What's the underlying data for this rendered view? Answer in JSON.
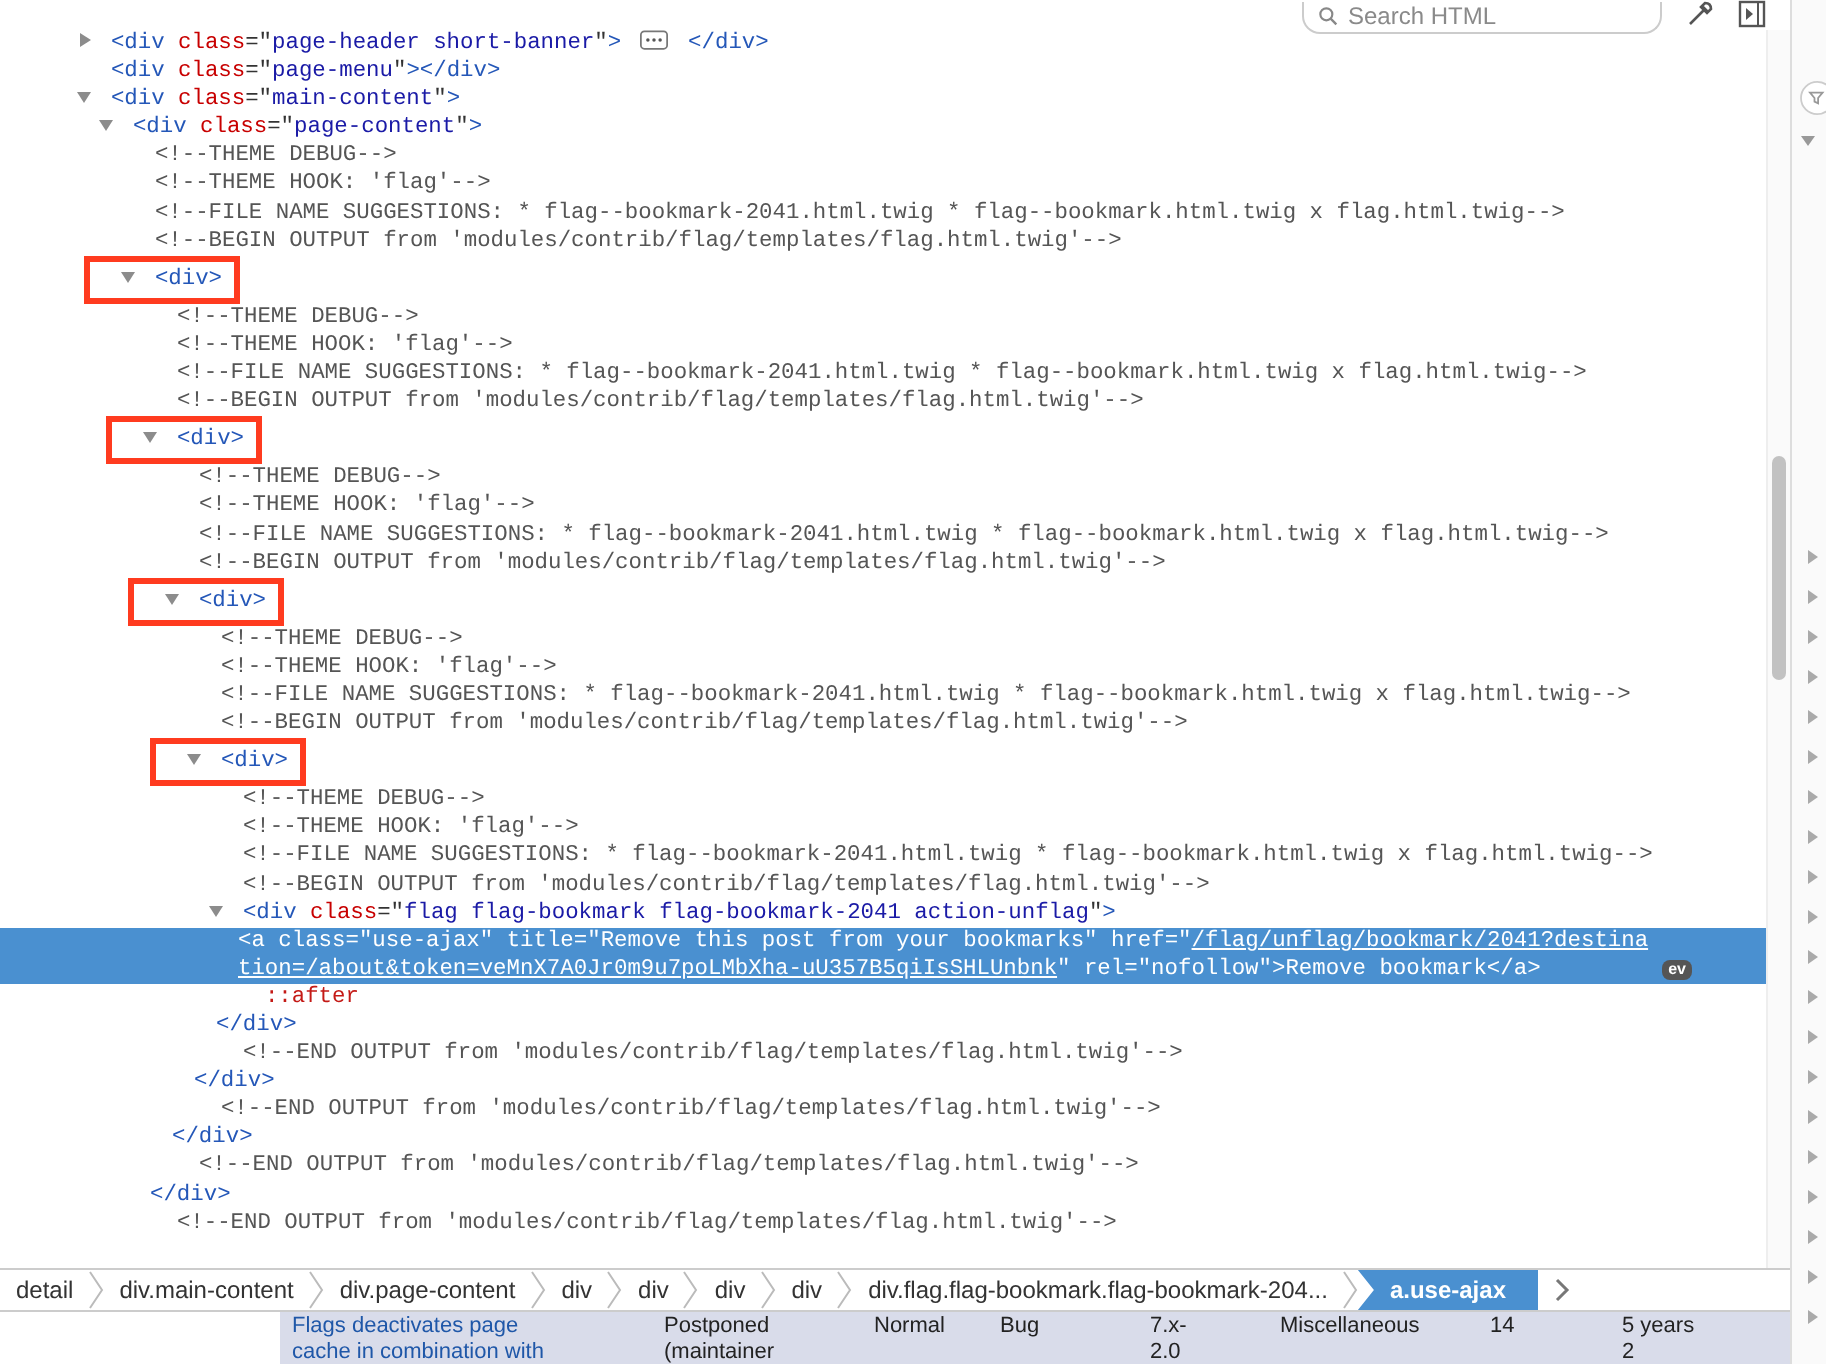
{
  "search": {
    "placeholder": "Search HTML"
  },
  "tree": [
    {
      "kind": "element",
      "selected": false,
      "boxed": false,
      "expanded": false,
      "code": [
        {
          "kind": "tag",
          "text": "<div"
        },
        {
          "kind": "attr",
          "text": " class"
        },
        {
          "kind": "punct",
          "text": "=\""
        },
        {
          "kind": "value",
          "text": "page-header short-banner"
        },
        {
          "kind": "punct",
          "text": "\""
        },
        {
          "kind": "tag",
          "text": ">"
        }
      ],
      "tail": [
        {
          "kind": "tag",
          "text": "</div>"
        }
      ]
    },
    {
      "kind": "element",
      "selected": false,
      "boxed": false,
      "code": [
        {
          "kind": "tag",
          "text": "<div"
        },
        {
          "kind": "attr",
          "text": " class"
        },
        {
          "kind": "punct",
          "text": "=\""
        },
        {
          "kind": "value",
          "text": "page-menu"
        },
        {
          "kind": "punct",
          "text": "\""
        },
        {
          "kind": "tag",
          "text": "></div>"
        }
      ]
    },
    {
      "kind": "element",
      "selected": false,
      "boxed": false,
      "expanded": true,
      "code": [
        {
          "kind": "tag",
          "text": "<div"
        },
        {
          "kind": "attr",
          "text": " class"
        },
        {
          "kind": "punct",
          "text": "=\""
        },
        {
          "kind": "value",
          "text": "main-content"
        },
        {
          "kind": "punct",
          "text": "\""
        },
        {
          "kind": "tag",
          "text": ">"
        }
      ],
      "children": [
        {
          "kind": "element",
          "selected": false,
          "boxed": false,
          "expanded": true,
          "code": [
            {
              "kind": "tag",
              "text": "<div"
            },
            {
              "kind": "attr",
              "text": " class"
            },
            {
              "kind": "punct",
              "text": "=\""
            },
            {
              "kind": "value",
              "text": "page-content"
            },
            {
              "kind": "punct",
              "text": "\""
            },
            {
              "kind": "tag",
              "text": ">"
            }
          ],
          "children": [
            {
              "kind": "comment",
              "selected": false,
              "boxed": false,
              "text": "<!--THEME DEBUG-->"
            },
            {
              "kind": "comment",
              "selected": false,
              "boxed": false,
              "text": "<!--THEME HOOK: 'flag'-->"
            },
            {
              "kind": "comment",
              "selected": false,
              "boxed": false,
              "text": "<!--FILE NAME SUGGESTIONS: * flag--bookmark-2041.html.twig * flag--bookmark.html.twig x flag.html.twig-->"
            },
            {
              "kind": "comment",
              "selected": false,
              "boxed": false,
              "text": "<!--BEGIN OUTPUT from 'modules/contrib/flag/templates/flag.html.twig'-->"
            },
            {
              "kind": "element",
              "selected": false,
              "boxed": true,
              "expanded": true,
              "code": [
                {
                  "kind": "tag",
                  "text": "<div>"
                }
              ],
              "children": [
                {
                  "kind": "comment",
                  "selected": false,
                  "boxed": false,
                  "text": "<!--THEME DEBUG-->"
                },
                {
                  "kind": "comment",
                  "selected": false,
                  "boxed": false,
                  "text": "<!--THEME HOOK: 'flag'-->"
                },
                {
                  "kind": "comment",
                  "selected": false,
                  "boxed": false,
                  "text": "<!--FILE NAME SUGGESTIONS: * flag--bookmark-2041.html.twig * flag--bookmark.html.twig x flag.html.twig-->"
                },
                {
                  "kind": "comment",
                  "selected": false,
                  "boxed": false,
                  "text": "<!--BEGIN OUTPUT from 'modules/contrib/flag/templates/flag.html.twig'-->"
                },
                {
                  "kind": "element",
                  "selected": false,
                  "boxed": true,
                  "expanded": true,
                  "code": [
                    {
                      "kind": "tag",
                      "text": "<div>"
                    }
                  ],
                  "closing": "</div>",
                  "children": [
                    {
                      "kind": "comment",
                      "selected": false,
                      "boxed": false,
                      "text": "<!--THEME DEBUG-->"
                    },
                    {
                      "kind": "comment",
                      "selected": false,
                      "boxed": false,
                      "text": "<!--THEME HOOK: 'flag'-->"
                    },
                    {
                      "kind": "comment",
                      "selected": false,
                      "boxed": false,
                      "text": "<!--FILE NAME SUGGESTIONS: * flag--bookmark-2041.html.twig * flag--bookmark.html.twig x flag.html.twig-->"
                    },
                    {
                      "kind": "comment",
                      "selected": false,
                      "boxed": false,
                      "text": "<!--BEGIN OUTPUT from 'modules/contrib/flag/templates/flag.html.twig'-->"
                    },
                    {
                      "kind": "element",
                      "selected": false,
                      "boxed": true,
                      "expanded": true,
                      "code": [
                        {
                          "kind": "tag",
                          "text": "<div>"
                        }
                      ],
                      "closing": "</div>",
                      "children": [
                        {
                          "kind": "comment",
                          "selected": false,
                          "boxed": false,
                          "text": "<!--THEME DEBUG-->"
                        },
                        {
                          "kind": "comment",
                          "selected": false,
                          "boxed": false,
                          "text": "<!--THEME HOOK: 'flag'-->"
                        },
                        {
                          "kind": "comment",
                          "selected": false,
                          "boxed": false,
                          "text": "<!--FILE NAME SUGGESTIONS: * flag--bookmark-2041.html.twig * flag--bookmark.html.twig x flag.html.twig-->"
                        },
                        {
                          "kind": "comment",
                          "selected": false,
                          "boxed": false,
                          "text": "<!--BEGIN OUTPUT from 'modules/contrib/flag/templates/flag.html.twig'-->"
                        },
                        {
                          "kind": "element",
                          "selected": false,
                          "boxed": true,
                          "expanded": true,
                          "code": [
                            {
                              "kind": "tag",
                              "text": "<div>"
                            }
                          ],
                          "closing": "</div>",
                          "children": [
                            {
                              "kind": "comment",
                              "selected": false,
                              "boxed": false,
                              "text": "<!--THEME DEBUG-->"
                            },
                            {
                              "kind": "comment",
                              "selected": false,
                              "boxed": false,
                              "text": "<!--THEME HOOK: 'flag'-->"
                            },
                            {
                              "kind": "comment",
                              "selected": false,
                              "boxed": false,
                              "text": "<!--FILE NAME SUGGESTIONS: * flag--bookmark-2041.html.twig * flag--bookmark.html.twig x flag.html.twig-->"
                            },
                            {
                              "kind": "comment",
                              "selected": false,
                              "boxed": false,
                              "text": "<!--BEGIN OUTPUT from 'modules/contrib/flag/templates/flag.html.twig'-->"
                            },
                            {
                              "kind": "element",
                              "selected": false,
                              "boxed": false,
                              "expanded": true,
                              "code": [
                                {
                                  "kind": "tag",
                                  "text": "<div"
                                },
                                {
                                  "kind": "attr",
                                  "text": " class"
                                },
                                {
                                  "kind": "punct",
                                  "text": "=\""
                                },
                                {
                                  "kind": "value",
                                  "text": "flag flag-bookmark flag-bookmark-2041 action-unflag"
                                },
                                {
                                  "kind": "punct",
                                  "text": "\""
                                },
                                {
                                  "kind": "tag",
                                  "text": ">"
                                }
                              ],
                              "closing": "</div>",
                              "children": [
                                {
                                  "kind": "element",
                                  "selected": true,
                                  "boxed": false,
                                  "code": [
                                    {
                                      "kind": "tag",
                                      "text": "<a"
                                    },
                                    {
                                      "kind": "attr",
                                      "text": " class"
                                    },
                                    {
                                      "kind": "punct",
                                      "text": "=\""
                                    },
                                    {
                                      "kind": "value",
                                      "text": "use-ajax"
                                    },
                                    {
                                      "kind": "punct",
                                      "text": "\""
                                    },
                                    {
                                      "kind": "attr",
                                      "text": " title"
                                    },
                                    {
                                      "kind": "punct",
                                      "text": "=\""
                                    },
                                    {
                                      "kind": "value",
                                      "text": "Remove this post from your bookmarks"
                                    },
                                    {
                                      "kind": "punct",
                                      "text": "\""
                                    },
                                    {
                                      "kind": "attr",
                                      "text": " href"
                                    },
                                    {
                                      "kind": "punct",
                                      "text": "=\""
                                    },
                                    {
                                      "kind": "link",
                                      "text": "/flag/unflag/bookmark/2041?destination=/about&token=veMnX7A0Jr0m9u7poLMbXha-uU357B5qiIsSHLUnbnk"
                                    },
                                    {
                                      "kind": "punct",
                                      "text": "\""
                                    },
                                    {
                                      "kind": "attr",
                                      "text": " rel"
                                    },
                                    {
                                      "kind": "punct",
                                      "text": "=\""
                                    },
                                    {
                                      "kind": "value",
                                      "text": "nofollow"
                                    },
                                    {
                                      "kind": "punct",
                                      "text": "\""
                                    },
                                    {
                                      "kind": "tag",
                                      "text": ">"
                                    },
                                    {
                                      "kind": "plain",
                                      "text": "Remove bookmark"
                                    },
                                    {
                                      "kind": "tag",
                                      "text": "</a>"
                                    }
                                  ],
                                  "badge": "ev"
                                },
                                {
                                  "kind": "pseudo",
                                  "selected": false,
                                  "boxed": false,
                                  "text": "::after"
                                }
                              ]
                            },
                            {
                              "kind": "comment",
                              "selected": false,
                              "boxed": false,
                              "text": "<!--END OUTPUT from 'modules/contrib/flag/templates/flag.html.twig'-->"
                            }
                          ]
                        },
                        {
                          "kind": "comment",
                          "selected": false,
                          "boxed": false,
                          "text": "<!--END OUTPUT from 'modules/contrib/flag/templates/flag.html.twig'-->"
                        }
                      ]
                    },
                    {
                      "kind": "comment",
                      "selected": false,
                      "boxed": false,
                      "text": "<!--END OUTPUT from 'modules/contrib/flag/templates/flag.html.twig'-->"
                    }
                  ]
                },
                {
                  "kind": "comment",
                  "selected": false,
                  "boxed": false,
                  "text": "<!--END OUTPUT from 'modules/contrib/flag/templates/flag.html.twig'-->"
                }
              ]
            }
          ]
        }
      ]
    }
  ],
  "breadcrumb": [
    {
      "text": "detail",
      "selected": false
    },
    {
      "text": "div.main-content",
      "selected": false
    },
    {
      "text": "div.page-content",
      "selected": false
    },
    {
      "text": "div",
      "selected": false
    },
    {
      "text": "div",
      "selected": false
    },
    {
      "text": "div",
      "selected": false
    },
    {
      "text": "div",
      "selected": false
    },
    {
      "text": "div.flag.flag-bookmark.flag-bookmark-204...",
      "selected": false
    },
    {
      "text": "a.use-ajax",
      "selected": true
    }
  ],
  "page_row": [
    {
      "kind": "link",
      "lines": [
        "Flags deactivates page",
        "cache in combination with"
      ]
    },
    {
      "kind": "text",
      "lines": [
        "Postponed",
        "(maintainer"
      ]
    },
    {
      "kind": "text",
      "lines": [
        "Normal"
      ]
    },
    {
      "kind": "text",
      "lines": [
        "Bug"
      ]
    },
    {
      "kind": "text",
      "lines": [
        "7.x-",
        "2.0"
      ]
    },
    {
      "kind": "text",
      "lines": [
        "Miscellaneous"
      ]
    },
    {
      "kind": "text",
      "lines": [
        "14"
      ]
    },
    {
      "kind": "text",
      "lines": [
        "5 years",
        "2"
      ]
    }
  ]
}
